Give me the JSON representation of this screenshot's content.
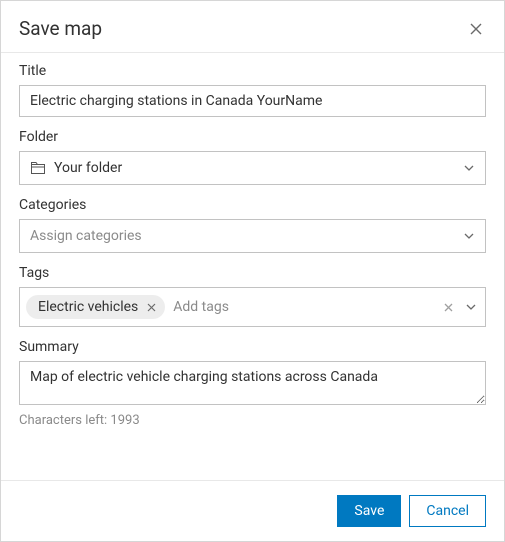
{
  "dialog": {
    "title": "Save map"
  },
  "fields": {
    "title": {
      "label": "Title",
      "value": "Electric charging stations in Canada YourName"
    },
    "folder": {
      "label": "Folder",
      "value": "Your folder"
    },
    "categories": {
      "label": "Categories",
      "placeholder": "Assign categories"
    },
    "tags": {
      "label": "Tags",
      "items": [
        "Electric vehicles"
      ],
      "placeholder": "Add tags"
    },
    "summary": {
      "label": "Summary",
      "value": "Map of electric vehicle charging stations across Canada",
      "helper": "Characters left: 1993"
    }
  },
  "footer": {
    "save": "Save",
    "cancel": "Cancel"
  }
}
